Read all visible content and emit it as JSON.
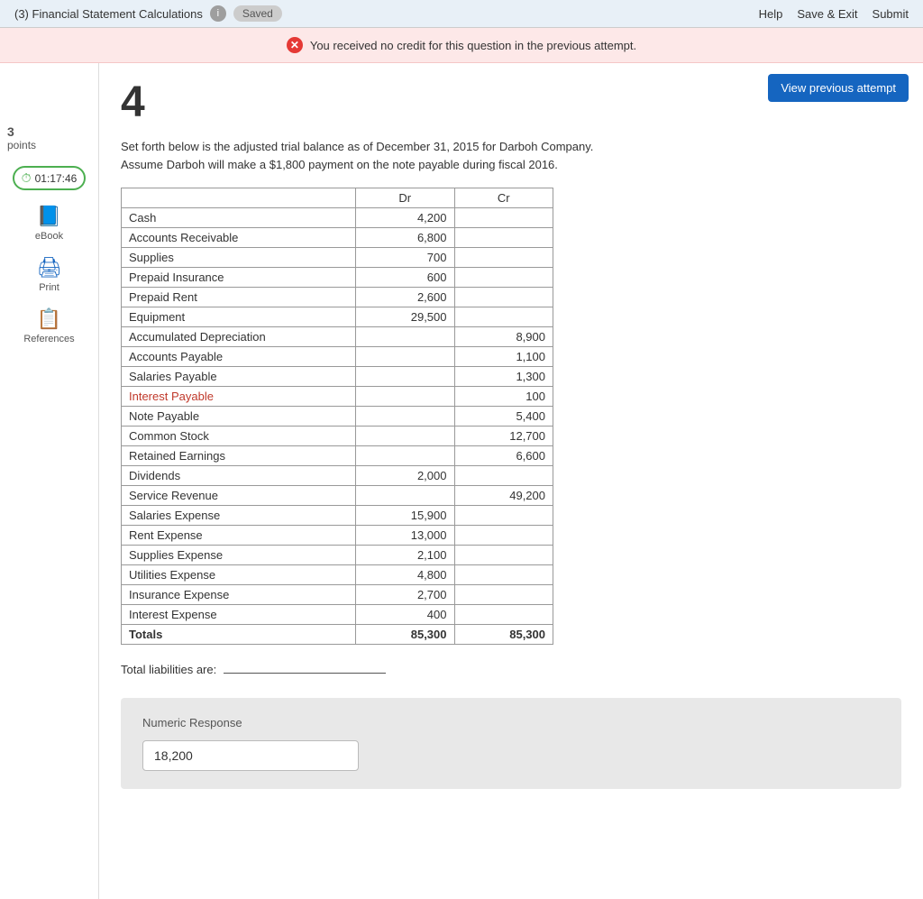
{
  "topBar": {
    "title": "(3) Financial Statement Calculations",
    "savedLabel": "Saved",
    "helpLabel": "Help",
    "saveExitLabel": "Save & Exit",
    "submitLabel": "Submit"
  },
  "alert": {
    "message": "You received no credit for this question in the previous attempt."
  },
  "viewPrevBtn": "View previous attempt",
  "questionNumber": "4",
  "points": "3",
  "pointsLabel": "points",
  "timer": "01:17:46",
  "sidebar": {
    "ebook": "eBook",
    "print": "Print",
    "references": "References"
  },
  "questionText1": "Set forth below is the adjusted trial balance as of December 31, 2015 for Darboh Company.",
  "questionText2": "Assume Darboh will make a $1,800 payment on the note payable during fiscal 2016.",
  "table": {
    "headers": [
      "",
      "Dr",
      "Cr"
    ],
    "rows": [
      {
        "account": "Cash",
        "dr": "4,200",
        "cr": ""
      },
      {
        "account": "Accounts Receivable",
        "dr": "6,800",
        "cr": ""
      },
      {
        "account": "Supplies",
        "dr": "700",
        "cr": ""
      },
      {
        "account": "Prepaid Insurance",
        "dr": "600",
        "cr": ""
      },
      {
        "account": "Prepaid Rent",
        "dr": "2,600",
        "cr": ""
      },
      {
        "account": "Equipment",
        "dr": "29,500",
        "cr": ""
      },
      {
        "account": "Accumulated Depreciation",
        "dr": "",
        "cr": "8,900"
      },
      {
        "account": "Accounts Payable",
        "dr": "",
        "cr": "1,100"
      },
      {
        "account": "Salaries Payable",
        "dr": "",
        "cr": "1,300"
      },
      {
        "account": "Interest Payable",
        "dr": "",
        "cr": "100",
        "highlight": true
      },
      {
        "account": "Note Payable",
        "dr": "",
        "cr": "5,400"
      },
      {
        "account": "Common Stock",
        "dr": "",
        "cr": "12,700"
      },
      {
        "account": "Retained Earnings",
        "dr": "",
        "cr": "6,600"
      },
      {
        "account": "Dividends",
        "dr": "2,000",
        "cr": ""
      },
      {
        "account": "Service Revenue",
        "dr": "",
        "cr": "49,200"
      },
      {
        "account": "Salaries Expense",
        "dr": "15,900",
        "cr": ""
      },
      {
        "account": "Rent Expense",
        "dr": "13,000",
        "cr": ""
      },
      {
        "account": "Supplies Expense",
        "dr": "2,100",
        "cr": ""
      },
      {
        "account": "Utilities Expense",
        "dr": "4,800",
        "cr": ""
      },
      {
        "account": "Insurance Expense",
        "dr": "2,700",
        "cr": ""
      },
      {
        "account": "Interest Expense",
        "dr": "400",
        "cr": ""
      },
      {
        "account": "Totals",
        "dr": "85,300",
        "cr": "85,300",
        "bold": true
      }
    ]
  },
  "totalLiabilities": {
    "label": "Total liabilities are:"
  },
  "numericSection": {
    "label": "Numeric Response",
    "value": "18,200",
    "placeholder": ""
  }
}
